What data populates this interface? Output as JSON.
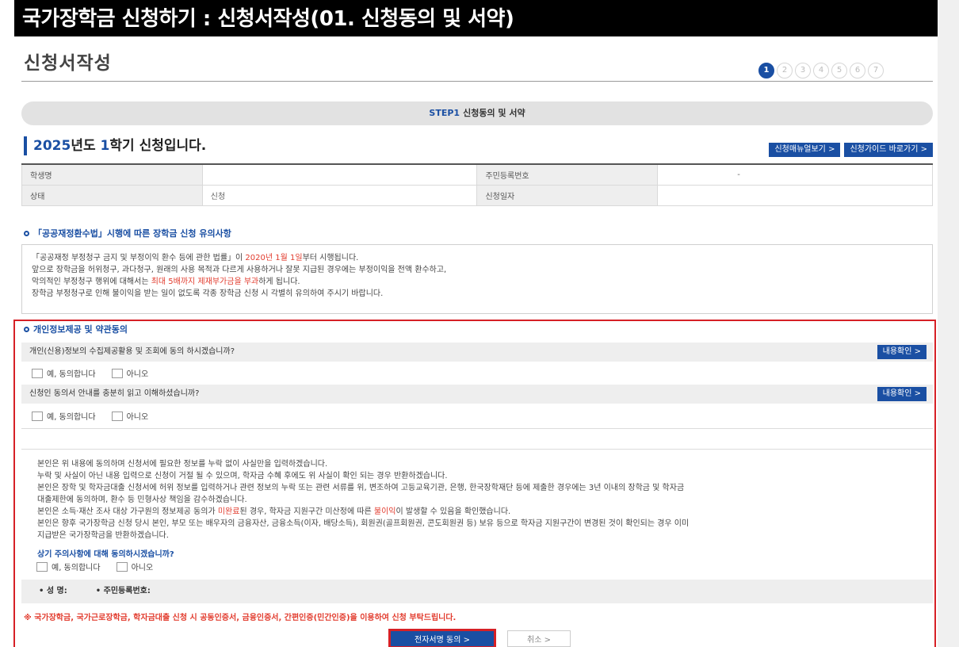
{
  "banner": {
    "title": "국가장학금 신청하기 : 신청서작성(01. 신청동의 및 서약)"
  },
  "page": {
    "title": "신청서작성"
  },
  "steps": [
    "1",
    "2",
    "3",
    "4",
    "5",
    "6",
    "7"
  ],
  "step_bar": {
    "step_no": "STEP1",
    "label": "신청동의 및 서약"
  },
  "semester": {
    "year": "2025",
    "year_suffix": "년도 ",
    "term": "1",
    "term_suffix": "학기 신청입니다."
  },
  "top_buttons": {
    "manual": "신청매뉴얼보기 >",
    "guide": "신청가이드 바로가기 >"
  },
  "info_table": {
    "student_name_label": "학생명",
    "student_name_value": "",
    "resident_no_label": "주민등록번호",
    "resident_no_value": "-",
    "status_label": "상태",
    "status_value": "신청",
    "apply_date_label": "신청일자",
    "apply_date_value": ""
  },
  "notice": {
    "title": "「공공재정환수법」시행에 따른 장학금 신청 유의사항",
    "line1_a": "「공공재정 부정청구 금지 및 부정이익 환수 등에 관한 법률」이 ",
    "line1_red": "2020년 1월 1일",
    "line1_b": "부터 시행됩니다.",
    "line2": "앞으로 장학금을 허위청구, 과다청구, 원래의 사용 목적과 다르게 사용하거나 잘못 지급된 경우에는 부정이익을 전액 환수하고,",
    "line3_a": "악의적인 부정청구 행위에 대해서는 ",
    "line3_red": "최대 5배까지 제재부가금을 부과",
    "line3_b": "하게 됩니다.",
    "line4": "장학금 부정청구로 인해 불이익을 받는 일이 없도록 각종 장학금 신청 시 각별히 유의하여 주시기 바랍니다."
  },
  "consent": {
    "title": "개인정보제공 및 약관동의",
    "q1": "개인(신용)정보의 수집제공활용 및 조회에 동의 하시겠습니까?",
    "q2": "신청인 동의서 안내를 충분히 읽고 이해하셨습니까?",
    "confirm_button": "내용확인 >",
    "agree": "예, 동의합니다",
    "disagree": "아니오"
  },
  "pledge": {
    "line1": "본인은 위 내용에 동의하며 신청서에 필요한 정보를 누락 없이 사실만을 입력하겠습니다.",
    "line2": "누락 및 사실이 아닌 내용 입력으로 신청이 거절 될 수 있으며, 학자금 수혜 후에도 위 사실이 확인 되는 경우 반환하겠습니다.",
    "line3": "본인은 장학 및 학자금대출 신청서에 허위 정보를 입력하거나 관련 정보의 누락 또는 관련 서류를 위, 변조하여 고등교육기관, 은행, 한국장학재단 등에 제출한 경우에는 3년 이내의 장학금 및 학자금",
    "line4": "대출제한에 동의하며, 환수 등 민형사상 책임을 감수하겠습니다.",
    "line5_a": "본인은 소득·재산 조사 대상 가구원의 정보제공 동의가 ",
    "line5_red1": "미완료",
    "line5_b": "된 경우, 학자금 지원구간 미산정에 따른 ",
    "line5_red2": "불이익",
    "line5_c": "이 발생할 수 있음을 확인했습니다.",
    "line6": "본인은 향후 국가장학금 신청 당시 본인, 부모 또는 배우자의 금융자산, 금융소득(이자, 배당소득), 회원권(골프회원권, 콘도회원권 등) 보유 등으로 학자금 지원구간이 변경된 것이 확인되는 경우 이미",
    "line7": "지급받은 국가장학금을 반환하겠습니다.",
    "question": "상기 주의사항에 대해 동의하시겠습니까?"
  },
  "sign_row": {
    "name_label": "• 성 명:",
    "resident_label": "• 주민등록번호:"
  },
  "warning": "※ 국가장학금, 국가근로장학금, 학자금대출 신청 시 공동인증서, 금융인증서, 간편인증(민간인증)을 이용하여 신청 부탁드립니다.",
  "buttons": {
    "submit": "전자서명 동의   >",
    "cancel": "취소   >"
  }
}
